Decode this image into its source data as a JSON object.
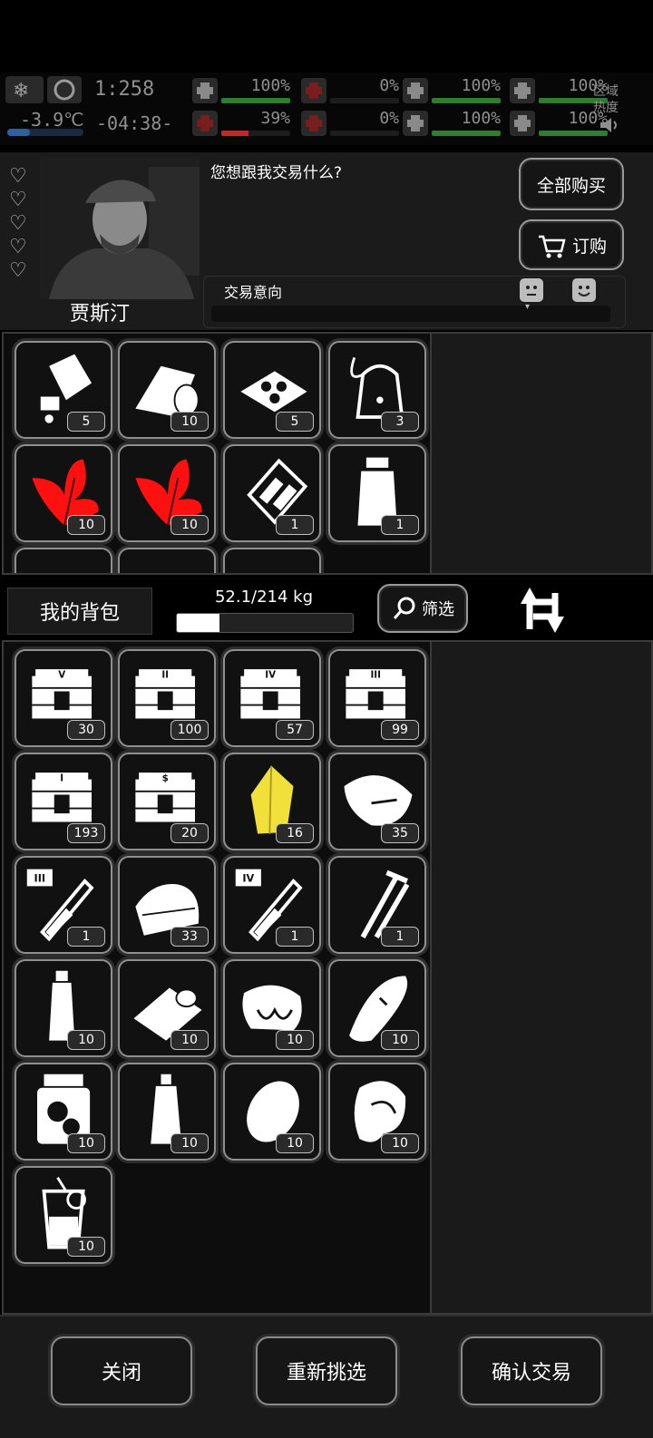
{
  "status": {
    "season_icon": "winter-snowflake-icon",
    "time_icon": "moon-icon",
    "clock": "1:258",
    "temperature": "-3.9℃",
    "timer": "-04:38-",
    "stats": [
      {
        "name": "health",
        "icon": "first-aid-icon",
        "value": "100%",
        "color": "#2e7d32",
        "fill": 1.0
      },
      {
        "name": "blood",
        "icon": "blood-icon",
        "value": "0%",
        "color": "#c62828",
        "fill": 0.0
      },
      {
        "name": "energy",
        "icon": "battery-icon",
        "value": "100%",
        "color": "#2e7d32",
        "fill": 1.0
      },
      {
        "name": "legs",
        "icon": "boot-icon",
        "value": "100%",
        "color": "#2e7d32",
        "fill": 1.0
      },
      {
        "name": "mind",
        "icon": "brain-icon",
        "value": "39%",
        "color": "#c62828",
        "fill": 0.39
      },
      {
        "name": "thirst",
        "icon": "drop-icon",
        "value": "0%",
        "color": "#c62828",
        "fill": 0.0
      },
      {
        "name": "heart",
        "icon": "heart-icon",
        "value": "100%",
        "color": "#2e7d32",
        "fill": 1.0
      },
      {
        "name": "other",
        "icon": "",
        "value": "100%",
        "color": "#2e7d32",
        "fill": 1.0
      }
    ],
    "area_label_1": "区域",
    "area_label_2": "热度",
    "sound_icon": "speaker-icon"
  },
  "trader": {
    "name": "贾斯汀",
    "hearts": 5,
    "dialog": "您想跟我交易什么?",
    "buy_all": "全部购买",
    "order": "订购",
    "intent_label": "交易意向"
  },
  "trader_items": [
    {
      "icon": "pill-bottle-icon",
      "count": "5",
      "color": "#ffffff"
    },
    {
      "icon": "bandage-roll-icon",
      "count": "10",
      "color": "#ffffff"
    },
    {
      "icon": "pills-tray-icon",
      "count": "5",
      "color": "#ffffff"
    },
    {
      "icon": "iv-bag-icon",
      "count": "3",
      "color": "#ffffff"
    },
    {
      "icon": "red-herb-icon",
      "count": "10",
      "color": "#ff1010"
    },
    {
      "icon": "red-herb-icon",
      "count": "10",
      "color": "#ff1010"
    },
    {
      "icon": "blister-pack-icon",
      "count": "1",
      "color": "#ffffff"
    },
    {
      "icon": "jar-icon",
      "count": "1",
      "color": "#ffffff"
    }
  ],
  "backpack": {
    "label": "我的背包",
    "weight": "52.1/214 kg",
    "weight_fill": 0.243,
    "filter": "筛选"
  },
  "my_items": [
    {
      "icon": "crate-v-icon",
      "count": "30",
      "color": "#ffffff"
    },
    {
      "icon": "crate-ii-icon",
      "count": "100",
      "color": "#ffffff"
    },
    {
      "icon": "crate-iv-icon",
      "count": "57",
      "color": "#ffffff"
    },
    {
      "icon": "crate-iii-icon",
      "count": "99",
      "color": "#ffffff"
    },
    {
      "icon": "crate-i-icon",
      "count": "193",
      "color": "#ffffff"
    },
    {
      "icon": "crate-special-icon",
      "count": "20",
      "color": "#ffffff"
    },
    {
      "icon": "yellow-crystal-icon",
      "count": "16",
      "color": "#f2e03a"
    },
    {
      "icon": "sweet-potato-icon",
      "count": "35",
      "color": "#ffffff"
    },
    {
      "icon": "test-tube-iii-icon",
      "count": "1",
      "color": "#ffffff"
    },
    {
      "icon": "cloth-icon",
      "count": "33",
      "color": "#ffffff"
    },
    {
      "icon": "test-tube-iv-icon",
      "count": "1",
      "color": "#ffffff"
    },
    {
      "icon": "nails-icon",
      "count": "1",
      "color": "#ffffff"
    },
    {
      "icon": "water-bottle-icon",
      "count": "10",
      "color": "#ffffff"
    },
    {
      "icon": "canned-food-icon",
      "count": "10",
      "color": "#ffffff"
    },
    {
      "icon": "meat-icon",
      "count": "10",
      "color": "#ffffff"
    },
    {
      "icon": "bread-icon",
      "count": "10",
      "color": "#ffffff"
    },
    {
      "icon": "pickle-jar-icon",
      "count": "10",
      "color": "#ffffff"
    },
    {
      "icon": "oil-bottle-icon",
      "count": "10",
      "color": "#ffffff"
    },
    {
      "icon": "potato-icon",
      "count": "10",
      "color": "#ffffff"
    },
    {
      "icon": "steak-icon",
      "count": "10",
      "color": "#ffffff"
    },
    {
      "icon": "lemonade-icon",
      "count": "10",
      "color": "#ffffff"
    }
  ],
  "footer": {
    "close": "关闭",
    "reselect": "重新挑选",
    "confirm": "确认交易"
  }
}
